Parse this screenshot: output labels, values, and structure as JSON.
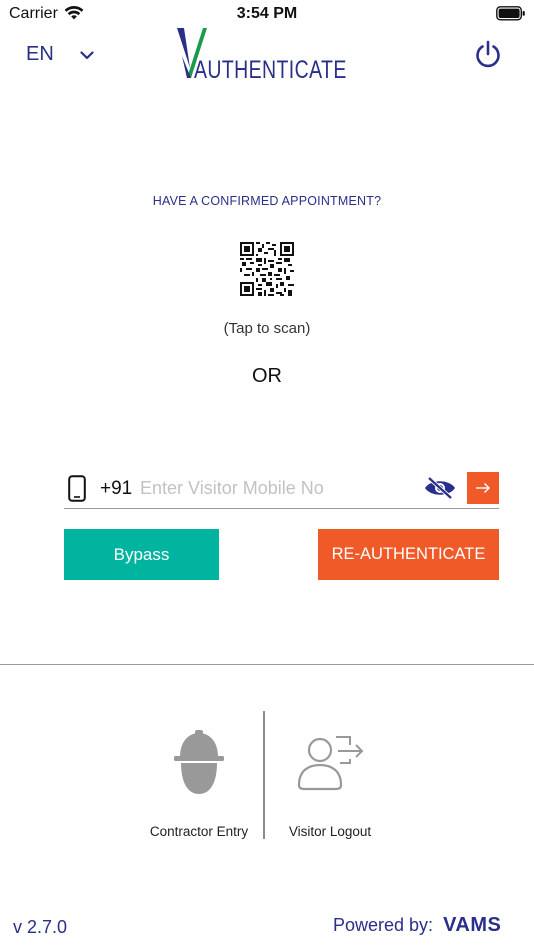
{
  "status_bar": {
    "carrier": "Carrier",
    "time": "3:54 PM"
  },
  "header": {
    "language": "EN",
    "logo_text": "AUTHENTICATE"
  },
  "appointment": {
    "prompt": "HAVE A CONFIRMED APPOINTMENT?",
    "tap_hint": "(Tap to scan)",
    "or_text": "OR"
  },
  "mobile": {
    "country_code": "+91",
    "placeholder": "Enter Visitor Mobile No",
    "value": ""
  },
  "actions": {
    "bypass_label": "Bypass",
    "reauth_label": "RE-AUTHENTICATE"
  },
  "bottom": {
    "contractor_label": "Contractor Entry",
    "visitor_logout_label": "Visitor Logout"
  },
  "footer": {
    "version": "v 2.7.0",
    "powered_by": "Powered by:",
    "brand": "VAMS"
  },
  "colors": {
    "primary_blue": "#2a2f8a",
    "accent_orange": "#f05a28",
    "teal": "#00b4a0",
    "logo_green": "#1a9a4a"
  },
  "icons": [
    "wifi-icon",
    "battery-icon",
    "chevron-down-icon",
    "power-icon",
    "qr-code-icon",
    "phone-icon",
    "eye-slash-icon",
    "arrow-right-icon",
    "hard-hat-icon",
    "user-logout-icon"
  ]
}
